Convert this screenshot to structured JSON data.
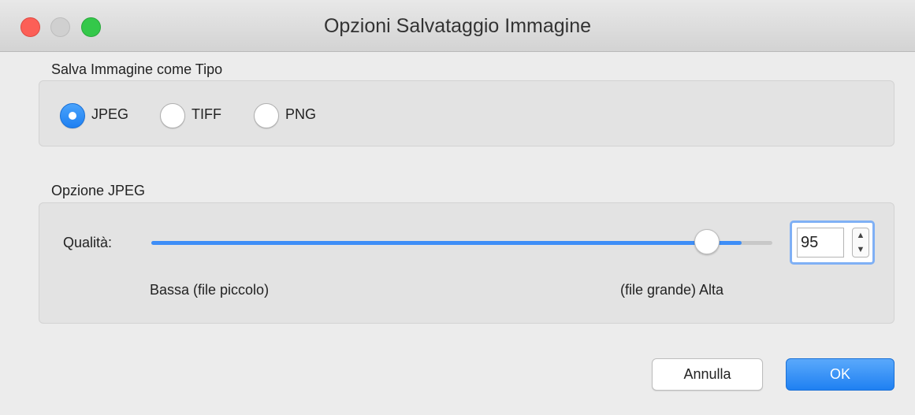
{
  "window": {
    "title": "Opzioni Salvataggio Immagine"
  },
  "save_type": {
    "label": "Salva Immagine come Tipo",
    "options": [
      {
        "label": "JPEG",
        "checked": true
      },
      {
        "label": "TIFF",
        "checked": false
      },
      {
        "label": "PNG",
        "checked": false
      }
    ]
  },
  "jpeg_options": {
    "label": "Opzione JPEG",
    "quality_label": "Qualità:",
    "quality_value": "95",
    "quality_fraction": 0.95,
    "low_label": "Bassa (file piccolo)",
    "high_label": "(file grande) Alta"
  },
  "buttons": {
    "cancel": "Annulla",
    "ok": "OK"
  },
  "colors": {
    "accent": "#3e8ef7",
    "close": "#fc5f57",
    "zoom": "#34c84a"
  }
}
